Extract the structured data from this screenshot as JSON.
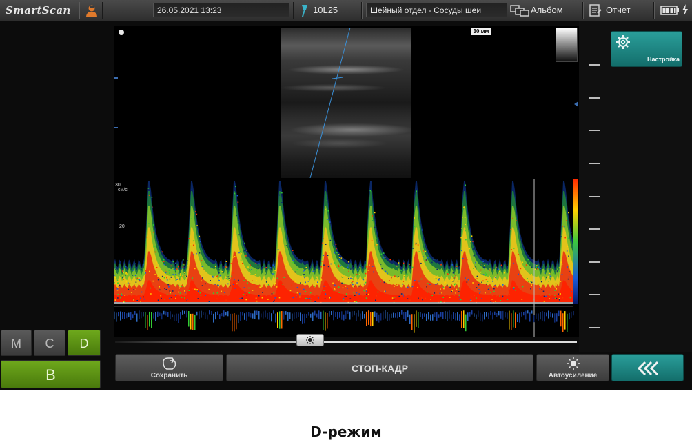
{
  "topbar": {
    "logo": "SmartScan",
    "datetime": "26.05.2021 13:23",
    "probe": "10L25",
    "preset": "Шейный отдел - Сосуды шеи",
    "album_label": "Альбом",
    "report_label": "Отчет"
  },
  "settings": {
    "label": "Настройка"
  },
  "image": {
    "depth_label": "30 мм",
    "spectrum_unit": "см/с",
    "scale_values": [
      "30",
      "20"
    ]
  },
  "modes": {
    "m": "M",
    "c": "C",
    "d": "D",
    "b": "B"
  },
  "active_modes": [
    "B",
    "D"
  ],
  "bottom": {
    "save_label": "Сохранить",
    "freeze_label": "СТОП-КАДР",
    "autogain_label": "Автоусиление",
    "back_symbol": "«"
  },
  "caption": "D-режим",
  "colors": {
    "accent_teal": "#1a8c88",
    "mode_active_green": "#5f9416",
    "topbar": "#3a3a3a"
  }
}
